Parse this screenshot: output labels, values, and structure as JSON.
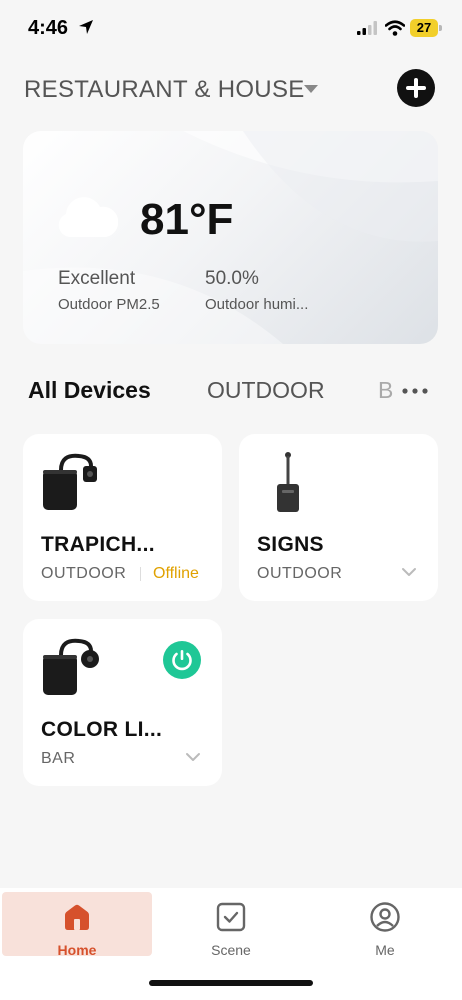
{
  "status_bar": {
    "time": "4:46",
    "battery": "27",
    "icons": [
      "location-arrow-icon",
      "signal-icon",
      "wifi-icon",
      "battery-icon"
    ]
  },
  "header": {
    "home_name": "RESTAURANT & HOUSE",
    "add_icon": "plus-circle-icon"
  },
  "weather": {
    "icon": "cloud-icon",
    "temperature": "81°F",
    "pm_value": "Excellent",
    "pm_label": "Outdoor PM2.5",
    "humidity_value": "50.0%",
    "humidity_label": "Outdoor humi..."
  },
  "tabs": [
    {
      "label": "All Devices",
      "active": true
    },
    {
      "label": "OUTDOOR",
      "active": false
    },
    {
      "label": "B",
      "active": false
    }
  ],
  "devices": [
    {
      "name": "TRAPICH...",
      "room": "OUTDOOR",
      "status": "Offline"
    },
    {
      "name": "SIGNS",
      "room": "OUTDOOR"
    },
    {
      "name": "COLOR LI...",
      "room": "BAR",
      "power": "on"
    }
  ],
  "nav": [
    {
      "label": "Home",
      "icon": "home-icon",
      "active": true
    },
    {
      "label": "Scene",
      "icon": "scene-check-icon",
      "active": false
    },
    {
      "label": "Me",
      "icon": "user-icon",
      "active": false
    }
  ],
  "colors": {
    "accent_active": "#d6512c",
    "power_on": "#1fc796",
    "offline": "#e0a100"
  }
}
